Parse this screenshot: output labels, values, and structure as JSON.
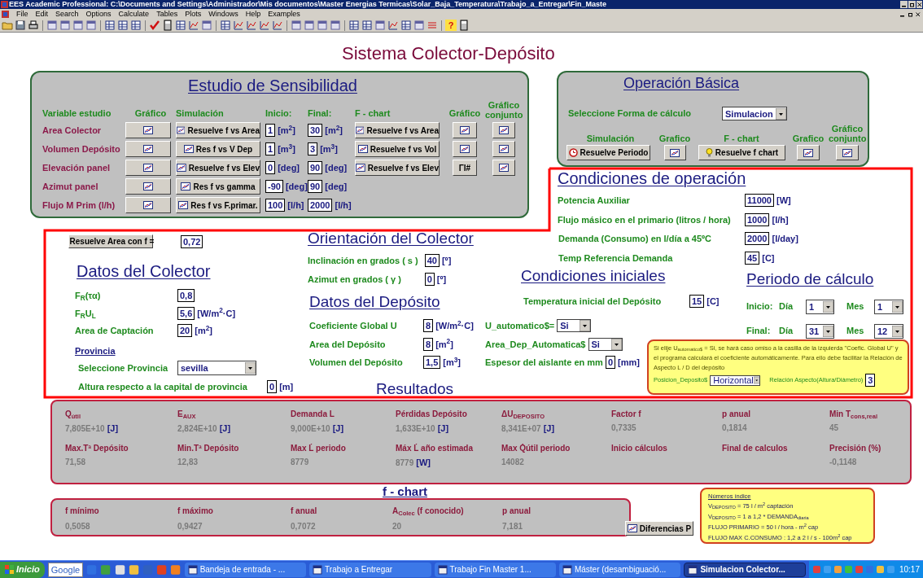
{
  "window": {
    "title": "EES Academic Professional:  C:\\Documents and Settings\\Administrador\\Mis documentos\\Master Energias Termicas\\Solar_Baja_Temperatura\\Trabajo_a_Entregar\\Fin_Maste"
  },
  "menu": [
    "File",
    "Edit",
    "Search",
    "Options",
    "Calculate",
    "Tables",
    "Plots",
    "Windows",
    "Help",
    "Examples"
  ],
  "toolbar": {
    "help_label": "?"
  },
  "heading": "Sistema Colector-Depósito",
  "sensitivity": {
    "title": "Estudio de Sensibilidad",
    "headers": [
      "Variable estudio",
      "Gráfico",
      "Simulación",
      "Inicio:",
      "Final:",
      "F - chart",
      "Gráfico",
      "Gráfico conjunto"
    ],
    "rows": [
      {
        "label": "Area Colector",
        "sim_button": "Resuelve f vs Area",
        "start": {
          "value": "1",
          "unit": "[m$^{2}$]"
        },
        "end": {
          "value": "30",
          "unit": "[m$^{2}$]"
        },
        "fchart_button": "Resuelve f vs Area",
        "fchart_plot": {
          "kind": "icon"
        },
        "combined_plot": true
      },
      {
        "label": "Volumen Depósito",
        "sim_button": "Res f vs V Dep",
        "start": {
          "value": "1",
          "unit": "[m$^{3}$]"
        },
        "end": {
          "value": "3",
          "unit": "[m$^{3}$]"
        },
        "fchart_button": "Resuelve f vs Vol",
        "fchart_plot": {
          "kind": "icon"
        },
        "combined_plot": true
      },
      {
        "label": "Elevación panel",
        "sim_button": "Resuelve f vs Elev",
        "start": {
          "value": "0",
          "unit": "[deg]"
        },
        "end": {
          "value": "90",
          "unit": "[deg]"
        },
        "fchart_button": "Resuelve f vs Elev",
        "fchart_plot": {
          "kind": "text",
          "label": "ΓI#"
        },
        "combined_plot": true
      },
      {
        "label": "Azimut panel",
        "sim_button": "Res f vs gamma",
        "start": {
          "value": "-90",
          "unit": "[deg]"
        },
        "end": {
          "value": "90",
          "unit": "[deg]"
        },
        "combined_plot": false
      },
      {
        "label": "Flujo M Prim (l/h)",
        "sim_button": "Res f vs F.primar.",
        "start": {
          "value": "100",
          "unit": "[l/h]"
        },
        "end": {
          "value": "2000",
          "unit": "[l/h]"
        },
        "combined_plot": false
      }
    ]
  },
  "basic": {
    "title": "Operación Básica",
    "select_label": "Seleccione Forma de cálculo",
    "select_value": "Simulacion",
    "headers": [
      "Simulación",
      "Grafico",
      "F - chart",
      "Grafico",
      "Gráfico conjunto"
    ],
    "period_button": "Resuelve Periodo",
    "fchart_button": "Resuelve f chart"
  },
  "operating": {
    "title": "Condiciones de operación",
    "rows": [
      {
        "label": "Potencia Auxiliar",
        "value": "11000",
        "unit": "[W]"
      },
      {
        "label": "Flujo másico en el primario (litros / hora)",
        "value": "1000",
        "unit": "[l/h]"
      },
      {
        "label": "Demanda (Consumo) en l/día a 45ºC",
        "value": "2000",
        "unit": "[l/day]"
      },
      {
        "label": "Temp Referencia Demanda",
        "value": "45",
        "unit": "[C]"
      }
    ]
  },
  "area_solver": {
    "button": "Resuelve Area con f =",
    "value": "0,72"
  },
  "collector": {
    "title": "Datos del Colector",
    "rows": [
      {
        "label": "F$_{R}$(τα)",
        "value": "0,8"
      },
      {
        "label": "F$_{R}$U$_{L}$",
        "value": "5,6",
        "unit": "[W/m$^{2}$·C]"
      },
      {
        "label": "Area de Captación",
        "value": "20",
        "unit": "[m$^{2}$]"
      }
    ],
    "province_title": "Provincia",
    "province_label": "Seleccione Provincia",
    "province_value": "sevilla",
    "altitude": {
      "label": "Altura respecto a la capital de provincia",
      "value": "0",
      "unit": "[m]"
    }
  },
  "orientation": {
    "title": "Orientación del Colector",
    "rows": [
      {
        "label": "Inclinación en grados  ( s )",
        "value": "40",
        "unit": "[º]"
      },
      {
        "label": "Azimut en grados ( γ )",
        "value": "0",
        "unit": "[º]"
      }
    ]
  },
  "tank": {
    "title": "Datos del Depósito",
    "rows": [
      {
        "label": "Coeficiente Global U",
        "value": "8",
        "unit": "[W/m$^{2}$·C]",
        "extra": {
          "kind": "select",
          "label": "U_automatico$=",
          "value": "Si"
        }
      },
      {
        "label": "Area del Depósito",
        "value": "8",
        "unit": "[m$^{2}$]",
        "extra": {
          "kind": "select",
          "label": "Area_Dep_Automatica$",
          "value": "Si"
        }
      },
      {
        "label": "Volumen del Depósito",
        "value": "1,5",
        "unit": "[m$^{3}$]",
        "extra": {
          "kind": "input",
          "label": "Espesor del aislante en mm",
          "value": "0",
          "unit": "[mm]"
        }
      }
    ]
  },
  "initial": {
    "title": "Condiciones iniciales",
    "label": "Temperatura inicial del Depósito",
    "value": "15",
    "unit": "[C]"
  },
  "period": {
    "title": "Periodo de cálculo",
    "rows": [
      {
        "label": "Inicio:",
        "day_label": "Día",
        "day": "1",
        "month_label": "Mes",
        "month": "1"
      },
      {
        "label": "Final:",
        "day_label": "Día",
        "day": "31",
        "month_label": "Mes",
        "month": "12"
      }
    ]
  },
  "note": {
    "text": "Si elije U$_{automatico$}$ = Si, se hará caso omiso a la casilla de la izquierda \"Coefic. Global U\" y el programa calculará el coeficiente automáticamente. Para ello debe facilitar la Relación de Aspecto L / D del depósito",
    "position_label": "Posicion_Deposito$",
    "position_value": "Horizontal",
    "ratio_label": "Relación Aspecto(Altura/Diámetro)",
    "ratio_value": "3"
  },
  "results_title": "Resultados",
  "results": {
    "rows": [
      [
        {
          "label": "Q$_{útil}$",
          "value": "7,805E+10",
          "unit": "[J]"
        },
        {
          "label": "E$_{AUX}$",
          "value": "2,824E+10",
          "unit": "[J]"
        },
        {
          "label": "Demanda L",
          "value": "9,000E+10",
          "unit": "[J]"
        },
        {
          "label": "Pérdidas Depósito",
          "value": "1,633E+10",
          "unit": "[J]"
        },
        {
          "label": "ΔU$_{DEPOSITO}$",
          "value": "8,341E+07",
          "unit": "[J]"
        },
        {
          "label": "Factor f",
          "value": "0,7335"
        },
        {
          "label": "p anual",
          "value": "0,1814"
        },
        {
          "label": "Min T$_{cons,real}$",
          "value": "45"
        }
      ],
      [
        {
          "label": "Max.Tª Depósito",
          "value": "71,58"
        },
        {
          "label": "Min.Tª Depósito",
          "value": "12,83"
        },
        {
          "label": "Max L̇ periodo",
          "value": "8779"
        },
        {
          "label": "Máx L̇ año estimada",
          "value": "8779",
          "unit": "[W]"
        },
        {
          "label": "Max Q̇útil periodo",
          "value": "14082"
        },
        {
          "label": "Inicio cálculos"
        },
        {
          "label": "Final de calculos"
        },
        {
          "label": "Precisión (%)",
          "value": "-0,1148"
        }
      ]
    ]
  },
  "fchart": {
    "title": "f - chart",
    "items": [
      {
        "label": "f mínimo",
        "value": "0,5058"
      },
      {
        "label": "f máximo",
        "value": "0,9427"
      },
      {
        "label": "f anual",
        "value": "0,7072"
      },
      {
        "label": "A$_{Colec}$ (f conocido)",
        "value": "20"
      },
      {
        "label": "p anual",
        "value": "7,181"
      }
    ],
    "button": "Diferencias P"
  },
  "index_note": {
    "title": "Números índice",
    "lines": [
      "V$_{DEPOSITO}$ = 75 l / m$^{2}$ captación",
      "V$_{DEPOSITO}$ = 1 a 1,2 * DEMANDA$_{diaria}$",
      "FLUJO PRIMARIO = 50 l / hora - m$^{2}$ cap",
      "FLUJO MAX C.CONSUMO : 1,2 a 2 l / s - 100m$^{2}$ cap"
    ]
  },
  "taskbar": {
    "start": "Inicio",
    "search": "Google",
    "tasks": [
      {
        "label": "Bandeja de entrada - ...",
        "selected": false
      },
      {
        "label": "Trabajo a Entregar",
        "selected": false
      },
      {
        "label": "Trabajo Fin Master 1...",
        "selected": false
      },
      {
        "label": "Máster (desambiguació...",
        "selected": false
      },
      {
        "label": "Simulacion Colector...",
        "selected": true
      }
    ],
    "clock": "10:17"
  }
}
